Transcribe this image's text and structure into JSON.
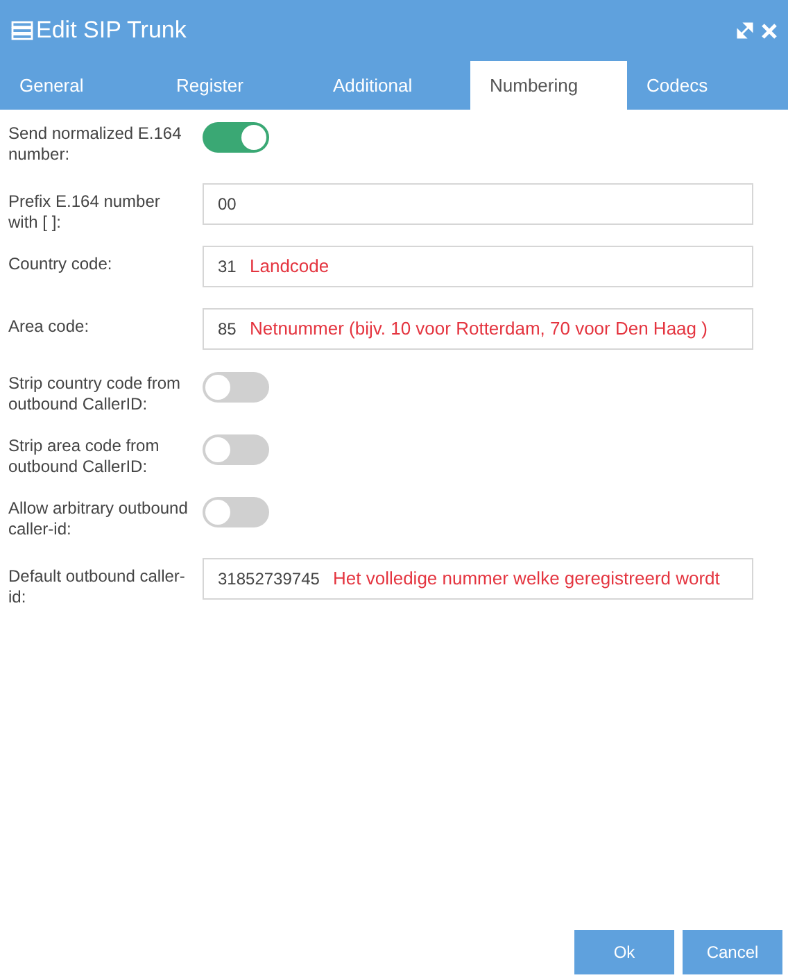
{
  "window": {
    "title": "Edit SIP Trunk"
  },
  "tabs": [
    {
      "label": "General",
      "selected": false
    },
    {
      "label": "Register",
      "selected": false
    },
    {
      "label": "Additional",
      "selected": false
    },
    {
      "label": "Numbering",
      "selected": true
    },
    {
      "label": "Codecs",
      "selected": false
    }
  ],
  "fields": [
    {
      "kind": "toggle",
      "label": "Send normalized E.164 number:",
      "on": true
    },
    {
      "kind": "text",
      "label": "Prefix E.164 number with [ ]:",
      "value": "00"
    },
    {
      "kind": "text",
      "label": "Country code:",
      "value": "31",
      "note": "Landcode"
    },
    {
      "kind": "text",
      "label": "Area code:",
      "value": "85",
      "note": "Netnummer (bijv. 10 voor Rotterdam, 70 voor Den Haag )"
    },
    {
      "kind": "toggle",
      "label": "Strip country code from outbound CallerID:",
      "on": false
    },
    {
      "kind": "toggle",
      "label": "Strip area code from outbound CallerID:",
      "on": false
    },
    {
      "kind": "toggle",
      "label": "Allow arbitrary outbound caller-id:",
      "on": false
    },
    {
      "kind": "text",
      "label": "Default outbound caller-id:",
      "value": "31852739745",
      "note": "Het volledige nummer welke geregistreerd wordt"
    }
  ],
  "buttons": [
    "Ok",
    "Cancel"
  ]
}
